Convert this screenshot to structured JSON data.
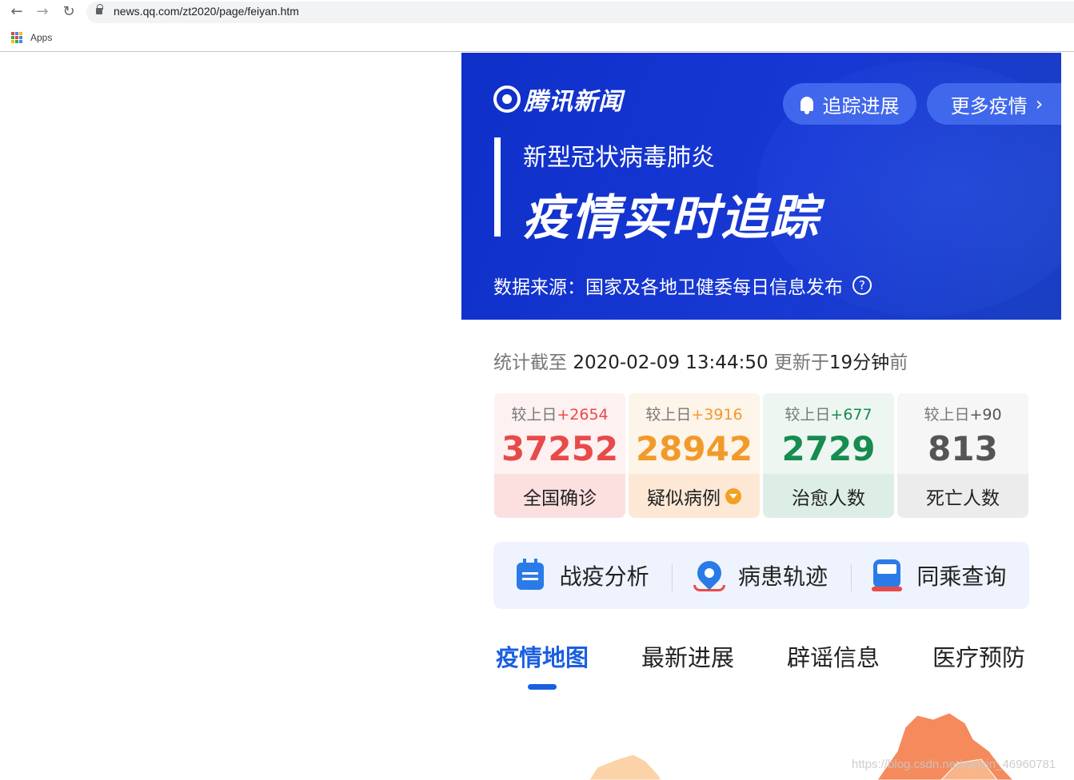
{
  "browser": {
    "url": "news.qq.com/zt2020/page/feiyan.htm",
    "bookmarks": {
      "apps_label": "Apps"
    },
    "icons": {
      "back": "arrow-left-icon",
      "forward": "arrow-right-icon",
      "reload": "reload-icon",
      "lock": "lock-icon",
      "apps": "apps-grid-icon"
    }
  },
  "banner": {
    "logo_text": "腾讯新闻",
    "track_button": "追踪进展",
    "more_button": "更多疫情",
    "subtitle": "新型冠状病毒肺炎",
    "headline": "疫情实时追踪",
    "source": "数据来源：国家及各地卫健委每日信息发布",
    "help_glyph": "?",
    "colors": {
      "background": "#1533cc",
      "pill": "#466ef0"
    }
  },
  "stats": {
    "time_prefix": "统计截至",
    "timestamp": "2020-02-09 13:44:50",
    "update_prefix": "更新于",
    "update_ago": "19分钟",
    "update_suffix": "前",
    "delta_prefix": "较上日",
    "cards": [
      {
        "delta": "+2654",
        "value": "37252",
        "label": "全国确诊",
        "color": "#e84a4a"
      },
      {
        "delta": "+3916",
        "value": "28942",
        "label": "疑似病例",
        "color": "#f19a2a"
      },
      {
        "delta": "+677",
        "value": "2729",
        "label": "治愈人数",
        "color": "#178b50"
      },
      {
        "delta": "+90",
        "value": "813",
        "label": "死亡人数",
        "color": "#555555"
      }
    ]
  },
  "tools": [
    {
      "label": "战疫分析",
      "icon": "calendar-icon"
    },
    {
      "label": "病患轨迹",
      "icon": "location-pin-icon"
    },
    {
      "label": "同乘查询",
      "icon": "train-icon"
    }
  ],
  "tabs": [
    {
      "label": "疫情地图",
      "active": true
    },
    {
      "label": "最新进展",
      "active": false
    },
    {
      "label": "辟谣信息",
      "active": false
    },
    {
      "label": "医疗预防",
      "active": false
    }
  ],
  "watermark": "https://blog.csdn.net/weixin_46960781"
}
